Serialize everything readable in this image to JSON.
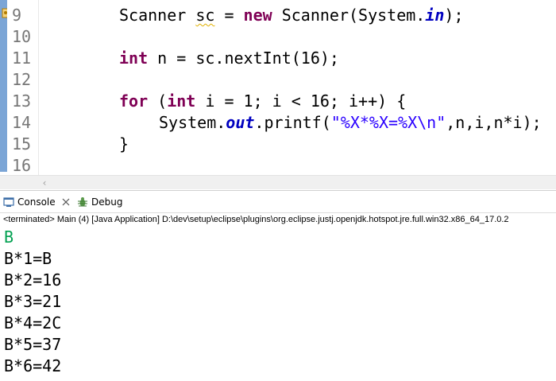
{
  "editor": {
    "line_numbers": [
      "9",
      "10",
      "11",
      "12",
      "13",
      "14",
      "15",
      "16"
    ],
    "lines": {
      "l9": {
        "a": "Scanner ",
        "b": "sc",
        "c": " = ",
        "d": "new",
        "e": " Scanner(System.",
        "f": "in",
        "g": ");"
      },
      "l11": {
        "a": "int",
        "b": " n = sc.nextInt(16);"
      },
      "l13": {
        "a": "for",
        "b": " (",
        "c": "int",
        "d": " i = 1; i < 16; i++) {"
      },
      "l14": {
        "a": "System.",
        "b": "out",
        "c": ".printf(",
        "d": "\"%X*%X=%X\\n\"",
        "e": ",n,i,n*i);"
      },
      "l15": {
        "a": "}"
      }
    }
  },
  "views": {
    "console_label": "Console",
    "debug_label": "Debug"
  },
  "console": {
    "status": "<terminated> Main (4) [Java Application] D:\\dev\\setup\\eclipse\\plugins\\org.eclipse.justj.openjdk.hotspot.jre.full.win32.x86_64_17.0.2",
    "input_echo": "B",
    "output": [
      "B*1=B",
      "B*2=16",
      "B*3=21",
      "B*4=2C",
      "B*5=37",
      "B*6=42"
    ]
  },
  "colors": {
    "keyword": "#7f0055",
    "field": "#0000c0",
    "string": "#2a00ff",
    "input": "#00a050"
  }
}
